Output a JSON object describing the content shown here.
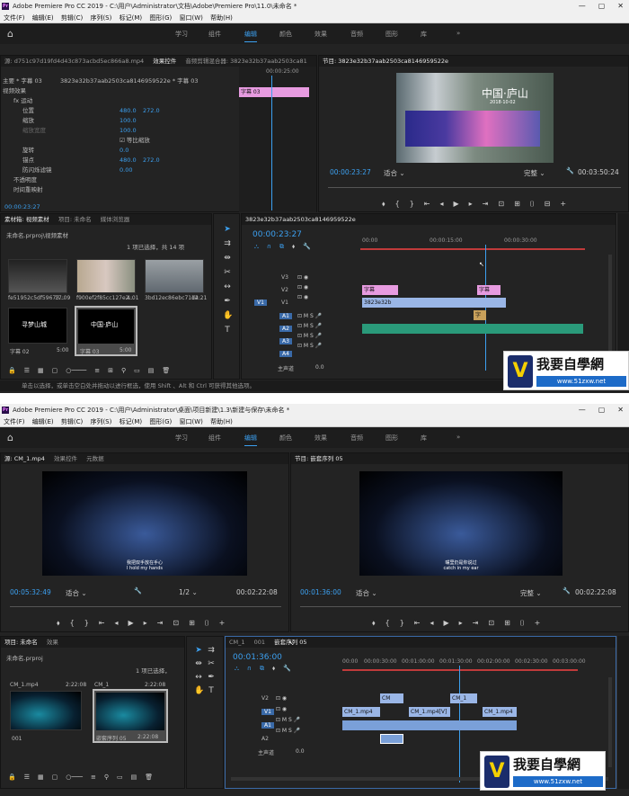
{
  "screen1": {
    "title": "Adobe Premiere Pro CC 2019 - C:\\用户\\Administrator\\文档\\Adobe\\Premiere Pro\\11.0\\未命名 *",
    "menu": [
      "文件(F)",
      "编辑(E)",
      "剪辑(C)",
      "序列(S)",
      "标记(M)",
      "图形(G)",
      "窗口(W)",
      "帮助(H)"
    ],
    "workspaces": [
      "学习",
      "组件",
      "编辑",
      "颜色",
      "效果",
      "音频",
      "图形",
      "库"
    ],
    "active_workspace": "编辑",
    "source_tab": "源: d751c97d19fd4d43c873acbd5ec866a8.mp4",
    "effect_controls_tab": "效果控件",
    "audio_mixer_tab": "音频剪辑混合器: 3823e32b37aab2503ca81",
    "master_clip": "主要 * 字幕 03",
    "seq_clip": "3823e32b37aab2503ca8146959522e * 字幕 03",
    "video_effects": "视频效果",
    "fx_motion": "fx 运动",
    "props": [
      {
        "name": "位置",
        "v1": "480.0",
        "v2": "272.0"
      },
      {
        "name": "缩放",
        "v1": "100.0",
        "v2": ""
      },
      {
        "name": "缩放宽度",
        "v1": "100.0",
        "v2": ""
      },
      {
        "name": "等比缩放",
        "v1": "",
        "v2": ""
      },
      {
        "name": "旋转",
        "v1": "0.0",
        "v2": ""
      },
      {
        "name": "锚点",
        "v1": "480.0",
        "v2": "272.0"
      },
      {
        "name": "防闪烁滤镜",
        "v1": "0.00",
        "v2": ""
      }
    ],
    "opacity": "不透明度",
    "time_remap": "时间重映射",
    "ec_timecode": "00:00:23:27",
    "ec_ruler": "00:00:25:00",
    "ec_clip": "字幕 03",
    "program_tab": "节目: 3823e32b37aab2503ca8146959522e",
    "program_tc": "00:00:23:27",
    "program_fit": "适合",
    "program_quality": "完整",
    "program_dur": "00:03:50:24",
    "video_title": "中国·庐山",
    "video_sub": "2018·10·02",
    "media_tab": "素材箱: 视频素材",
    "project_tab": "项目: 未命名",
    "browser_tab": "媒体浏览器",
    "bin_path": "未命名.prproj\\视频素材",
    "bin_count": "1 项已选择，共 14 项",
    "thumbs": [
      {
        "name": "fe51952c5df59673...",
        "dur": "17:09"
      },
      {
        "name": "f900ef2f85cc127e2...",
        "dur": "4:01"
      },
      {
        "name": "3bd12ec86ebc71d4...",
        "dur": "12:21"
      },
      {
        "name": "字幕 02",
        "dur": "5:00"
      },
      {
        "name": "字幕 03",
        "dur": "5:00"
      }
    ],
    "thumb_text1": "寻梦山城",
    "thumb_text2": "中国·庐山",
    "seq_tab": "3823e32b37aab2503ca8146959522e",
    "seq_tc": "00:00:23:27",
    "ruler": [
      "00:00",
      "00:00:15:00",
      "00:00:30:00"
    ],
    "tracks_v": [
      "V3",
      "V2",
      "V1"
    ],
    "tracks_a": [
      "A1",
      "A2",
      "A3",
      "A4"
    ],
    "master": "主声道",
    "master_val": "0.0",
    "clips": [
      "字幕",
      "字幕",
      "3823e32b",
      "字"
    ],
    "status": "单击以选择，或单击空白处并拖动以进行框选，使用 Shift 、Alt 和 Ctrl 可获得其他选项。"
  },
  "screen2": {
    "title": "Adobe Premiere Pro CC 2019 - C:\\用户\\Administrator\\桌面\\项目新建\\1.3\\新建与保存\\未命名 *",
    "menu": [
      "文件(F)",
      "编辑(E)",
      "剪辑(C)",
      "序列(S)",
      "标记(M)",
      "图形(G)",
      "窗口(W)",
      "帮助(H)"
    ],
    "workspaces": [
      "学习",
      "组件",
      "编辑",
      "颜色",
      "效果",
      "音频",
      "图形",
      "库"
    ],
    "active_workspace": "编辑",
    "source_tab": "源: CM_1.mp4",
    "effect_tab": "效果控件",
    "meta_tab": "元数据",
    "program_tab": "节目: 嵌套序列 05",
    "src_tc": "00:05:32:49",
    "src_fit": "适合",
    "src_res": "1/2",
    "src_dur": "00:02:22:08",
    "prg_tc": "00:01:36:00",
    "prg_fit": "适合",
    "prg_quality": "完整",
    "prg_dur": "00:02:22:08",
    "sub_src_cn": "我把双手放在手心",
    "sub_src_en": "I hold my hands",
    "sub_prg_cn": "嘴里仍是你说过",
    "sub_prg_en": "catch in my ear",
    "project_tab": "项目: 未命名",
    "fx_tab": "效果",
    "project_path": "未命名.prproj",
    "project_count": "1 项已选择，",
    "items": [
      {
        "name": "CM_1.mp4",
        "dur": "2:22:08"
      },
      {
        "name": "CM_1",
        "dur": "2:22:08"
      },
      {
        "name": "001",
        "dur": ""
      },
      {
        "name": "嵌套序列 05",
        "dur": "2:22:08"
      }
    ],
    "tl_tabs": [
      "CM_1",
      "001",
      "嵌套序列 05"
    ],
    "seq_tc": "00:01:36:00",
    "ruler": [
      "00:00",
      "00:00:30:00",
      "00:01:00:00",
      "00:01:30:00",
      "00:02:00:00",
      "00:02:30:00",
      "00:03:00:00"
    ],
    "tracks": [
      "V2",
      "V1",
      "A1",
      "A2"
    ],
    "master": "主声道",
    "master_val": "0.0",
    "clips": [
      "CM",
      "CM_1.mp4",
      "CM_1.mp4[V]",
      "CM_1",
      "CM_1.mp4"
    ]
  },
  "watermark": {
    "text": "我要自學網",
    "url": "www.51zxw.net"
  }
}
